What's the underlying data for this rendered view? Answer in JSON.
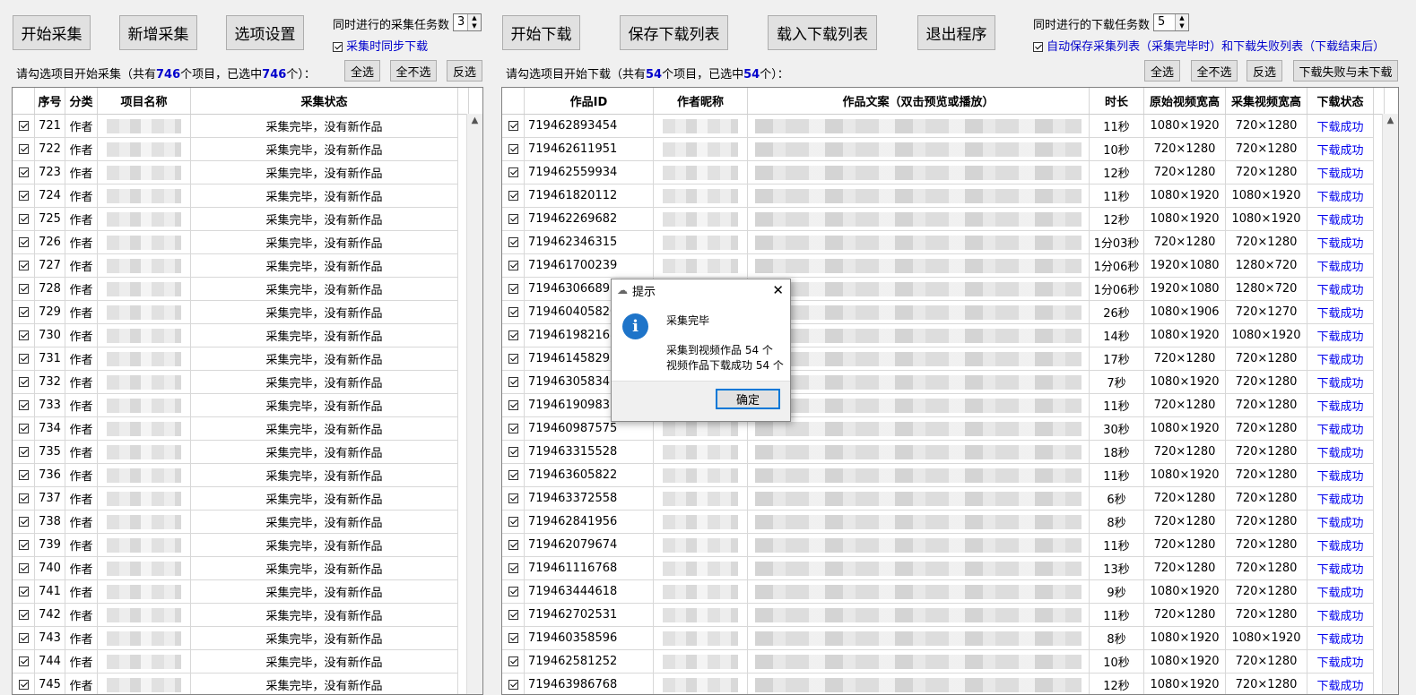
{
  "top_buttons": {
    "start_collect": "开始采集",
    "add_collect": "新增采集",
    "options": "选项设置",
    "start_download": "开始下载",
    "save_list": "保存下载列表",
    "load_list": "载入下载列表",
    "exit": "退出程序"
  },
  "collect_settings": {
    "concurrent_label": "同时进行的采集任务数",
    "concurrent_value": "3",
    "sync_download_label": "采集时同步下载"
  },
  "download_settings": {
    "concurrent_label": "同时进行的下载任务数",
    "concurrent_value": "5",
    "autosave_label": "自动保存采集列表（采集完毕时）和下载失败列表（下载结束后）"
  },
  "collect_panel": {
    "summary_prefix": "请勾选项目开始采集（共有",
    "total": "746",
    "summary_mid": "个项目，已选中",
    "selected": "746",
    "summary_suffix": "个）：",
    "select_all": "全选",
    "select_none": "全不选",
    "invert": "反选",
    "headers": [
      "序号",
      "分类",
      "项目名称",
      "采集状态"
    ],
    "rows": [
      {
        "no": "721",
        "type": "作者",
        "status": "采集完毕，没有新作品"
      },
      {
        "no": "722",
        "type": "作者",
        "status": "采集完毕，没有新作品"
      },
      {
        "no": "723",
        "type": "作者",
        "status": "采集完毕，没有新作品"
      },
      {
        "no": "724",
        "type": "作者",
        "status": "采集完毕，没有新作品"
      },
      {
        "no": "725",
        "type": "作者",
        "status": "采集完毕，没有新作品"
      },
      {
        "no": "726",
        "type": "作者",
        "status": "采集完毕，没有新作品"
      },
      {
        "no": "727",
        "type": "作者",
        "status": "采集完毕，没有新作品"
      },
      {
        "no": "728",
        "type": "作者",
        "status": "采集完毕，没有新作品"
      },
      {
        "no": "729",
        "type": "作者",
        "status": "采集完毕，没有新作品"
      },
      {
        "no": "730",
        "type": "作者",
        "status": "采集完毕，没有新作品"
      },
      {
        "no": "731",
        "type": "作者",
        "status": "采集完毕，没有新作品"
      },
      {
        "no": "732",
        "type": "作者",
        "status": "采集完毕，没有新作品"
      },
      {
        "no": "733",
        "type": "作者",
        "status": "采集完毕，没有新作品"
      },
      {
        "no": "734",
        "type": "作者",
        "status": "采集完毕，没有新作品"
      },
      {
        "no": "735",
        "type": "作者",
        "status": "采集完毕，没有新作品"
      },
      {
        "no": "736",
        "type": "作者",
        "status": "采集完毕，没有新作品"
      },
      {
        "no": "737",
        "type": "作者",
        "status": "采集完毕，没有新作品"
      },
      {
        "no": "738",
        "type": "作者",
        "status": "采集完毕，没有新作品"
      },
      {
        "no": "739",
        "type": "作者",
        "status": "采集完毕，没有新作品"
      },
      {
        "no": "740",
        "type": "作者",
        "status": "采集完毕，没有新作品"
      },
      {
        "no": "741",
        "type": "作者",
        "status": "采集完毕，没有新作品"
      },
      {
        "no": "742",
        "type": "作者",
        "status": "采集完毕，没有新作品"
      },
      {
        "no": "743",
        "type": "作者",
        "status": "采集完毕，没有新作品"
      },
      {
        "no": "744",
        "type": "作者",
        "status": "采集完毕，没有新作品"
      },
      {
        "no": "745",
        "type": "作者",
        "status": "采集完毕，没有新作品"
      }
    ]
  },
  "download_panel": {
    "summary_prefix": "请勾选项目开始下载（共有",
    "total": "54",
    "summary_mid": "个项目，已选中",
    "selected": "54",
    "summary_suffix": "个）：",
    "select_all": "全选",
    "select_none": "全不选",
    "invert": "反选",
    "failed_undone": "下载失败与未下载",
    "headers": [
      "作品ID",
      "作者昵称",
      "作品文案（双击预览或播放）",
      "时长",
      "原始视频宽高",
      "采集视频宽高",
      "下载状态"
    ],
    "rows": [
      {
        "id": "719462893454",
        "dur": "11秒",
        "orig": "1080×1920",
        "coll": "720×1280",
        "status": "下载成功"
      },
      {
        "id": "719462611951",
        "dur": "10秒",
        "orig": "720×1280",
        "coll": "720×1280",
        "status": "下载成功"
      },
      {
        "id": "719462559934",
        "dur": "12秒",
        "orig": "720×1280",
        "coll": "720×1280",
        "status": "下载成功"
      },
      {
        "id": "719461820112",
        "dur": "11秒",
        "orig": "1080×1920",
        "coll": "1080×1920",
        "status": "下载成功"
      },
      {
        "id": "719462269682",
        "dur": "12秒",
        "orig": "1080×1920",
        "coll": "1080×1920",
        "status": "下载成功"
      },
      {
        "id": "719462346315",
        "dur": "1分03秒",
        "orig": "720×1280",
        "coll": "720×1280",
        "status": "下载成功"
      },
      {
        "id": "719461700239",
        "dur": "1分06秒",
        "orig": "1920×1080",
        "coll": "1280×720",
        "status": "下载成功"
      },
      {
        "id": "719463066893",
        "dur": "1分06秒",
        "orig": "1920×1080",
        "coll": "1280×720",
        "status": "下载成功"
      },
      {
        "id": "719460405820",
        "dur": "26秒",
        "orig": "1080×1906",
        "coll": "720×1270",
        "status": "下载成功"
      },
      {
        "id": "719461982168",
        "dur": "14秒",
        "orig": "1080×1920",
        "coll": "1080×1920",
        "status": "下载成功"
      },
      {
        "id": "719461458292",
        "dur": "17秒",
        "orig": "720×1280",
        "coll": "720×1280",
        "status": "下载成功"
      },
      {
        "id": "719463058347",
        "dur": "7秒",
        "orig": "1080×1920",
        "coll": "720×1280",
        "status": "下载成功"
      },
      {
        "id": "719461909833",
        "dur": "11秒",
        "orig": "720×1280",
        "coll": "720×1280",
        "status": "下载成功"
      },
      {
        "id": "719460987575",
        "dur": "30秒",
        "orig": "1080×1920",
        "coll": "720×1280",
        "status": "下载成功"
      },
      {
        "id": "719463315528",
        "dur": "18秒",
        "orig": "720×1280",
        "coll": "720×1280",
        "status": "下载成功"
      },
      {
        "id": "719463605822",
        "dur": "11秒",
        "orig": "1080×1920",
        "coll": "720×1280",
        "status": "下载成功"
      },
      {
        "id": "719463372558",
        "dur": "6秒",
        "orig": "720×1280",
        "coll": "720×1280",
        "status": "下载成功"
      },
      {
        "id": "719462841956",
        "dur": "8秒",
        "orig": "720×1280",
        "coll": "720×1280",
        "status": "下载成功"
      },
      {
        "id": "719462079674",
        "dur": "11秒",
        "orig": "720×1280",
        "coll": "720×1280",
        "status": "下载成功"
      },
      {
        "id": "719461116768",
        "dur": "13秒",
        "orig": "720×1280",
        "coll": "720×1280",
        "status": "下载成功"
      },
      {
        "id": "719463444618",
        "dur": "9秒",
        "orig": "1080×1920",
        "coll": "720×1280",
        "status": "下载成功"
      },
      {
        "id": "719462702531",
        "dur": "11秒",
        "orig": "720×1280",
        "coll": "720×1280",
        "status": "下载成功"
      },
      {
        "id": "719460358596",
        "dur": "8秒",
        "orig": "1080×1920",
        "coll": "1080×1920",
        "status": "下载成功"
      },
      {
        "id": "719462581252",
        "dur": "10秒",
        "orig": "1080×1920",
        "coll": "720×1280",
        "status": "下载成功"
      },
      {
        "id": "719463986768",
        "dur": "12秒",
        "orig": "1080×1920",
        "coll": "720×1280",
        "status": "下载成功"
      }
    ]
  },
  "dialog": {
    "title": "提示",
    "line1": "采集完毕",
    "line2": "采集到视频作品 54 个",
    "line3": "视频作品下载成功 54 个",
    "ok": "确定"
  },
  "colors": {
    "count_blue": "#0000cc",
    "link_blue": "#0000ee",
    "info_icon": "#1e74c9"
  }
}
